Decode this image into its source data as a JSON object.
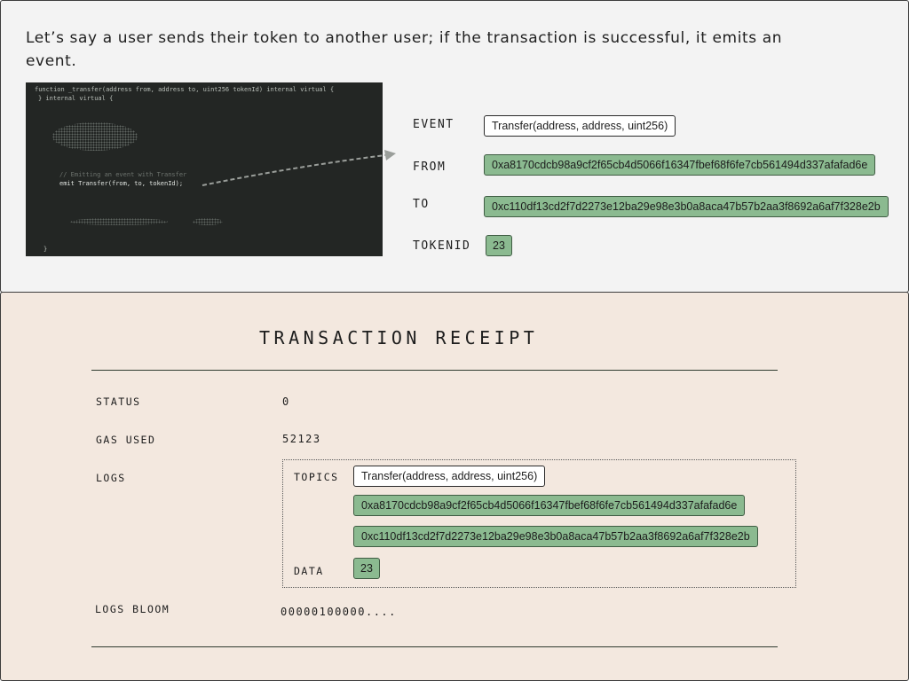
{
  "intro": "Let’s say a user sends their token to another user; if the transaction is successful, it emits an event.",
  "code": {
    "line1": "function _transfer(address from, address to, uint256 tokenId) internal virtual {",
    "line2": "} internal virtual {",
    "comment": "// Emitting an event with Transfer",
    "emit": "emit Transfer(from, to, tokenId);",
    "close": "}"
  },
  "event": {
    "event_label": "EVENT",
    "event_value": "Transfer(address, address, uint256)",
    "from_label": "FROM",
    "from_value": "0xa8170cdcb98a9cf2f65cb4d5066f16347fbef68f6fe7cb561494d337afafad6e",
    "to_label": "TO",
    "to_value": "0xc110df13cd2f7d2273e12ba29e98e3b0a8aca47b57b2aa3f8692a6af7f328e2b",
    "tokenid_label": "TOKENID",
    "tokenid_value": "23"
  },
  "receipt": {
    "title": "TRANSACTION RECEIPT",
    "status_label": "STATUS",
    "status_value": "0",
    "gas_label": "GAS USED",
    "gas_value": "52123",
    "logs_label": "LOGS",
    "topics_label": "TOPICS",
    "topic1": "Transfer(address, address, uint256)",
    "topic2": "0xa8170cdcb98a9cf2f65cb4d5066f16347fbef68f6fe7cb561494d337afafad6e",
    "topic3": "0xc110df13cd2f7d2273e12ba29e98e3b0a8aca47b57b2aa3f8692a6af7f328e2b",
    "data_label": "DATA",
    "data_value": "23",
    "bloom_label": "LOGS BLOOM",
    "bloom_value": "00000100000...."
  },
  "colors": {
    "top_panel_bg": "#f3f3f3",
    "bottom_panel_bg": "#f3e8df",
    "code_bg": "#232624",
    "green_box": "#8bba90"
  }
}
